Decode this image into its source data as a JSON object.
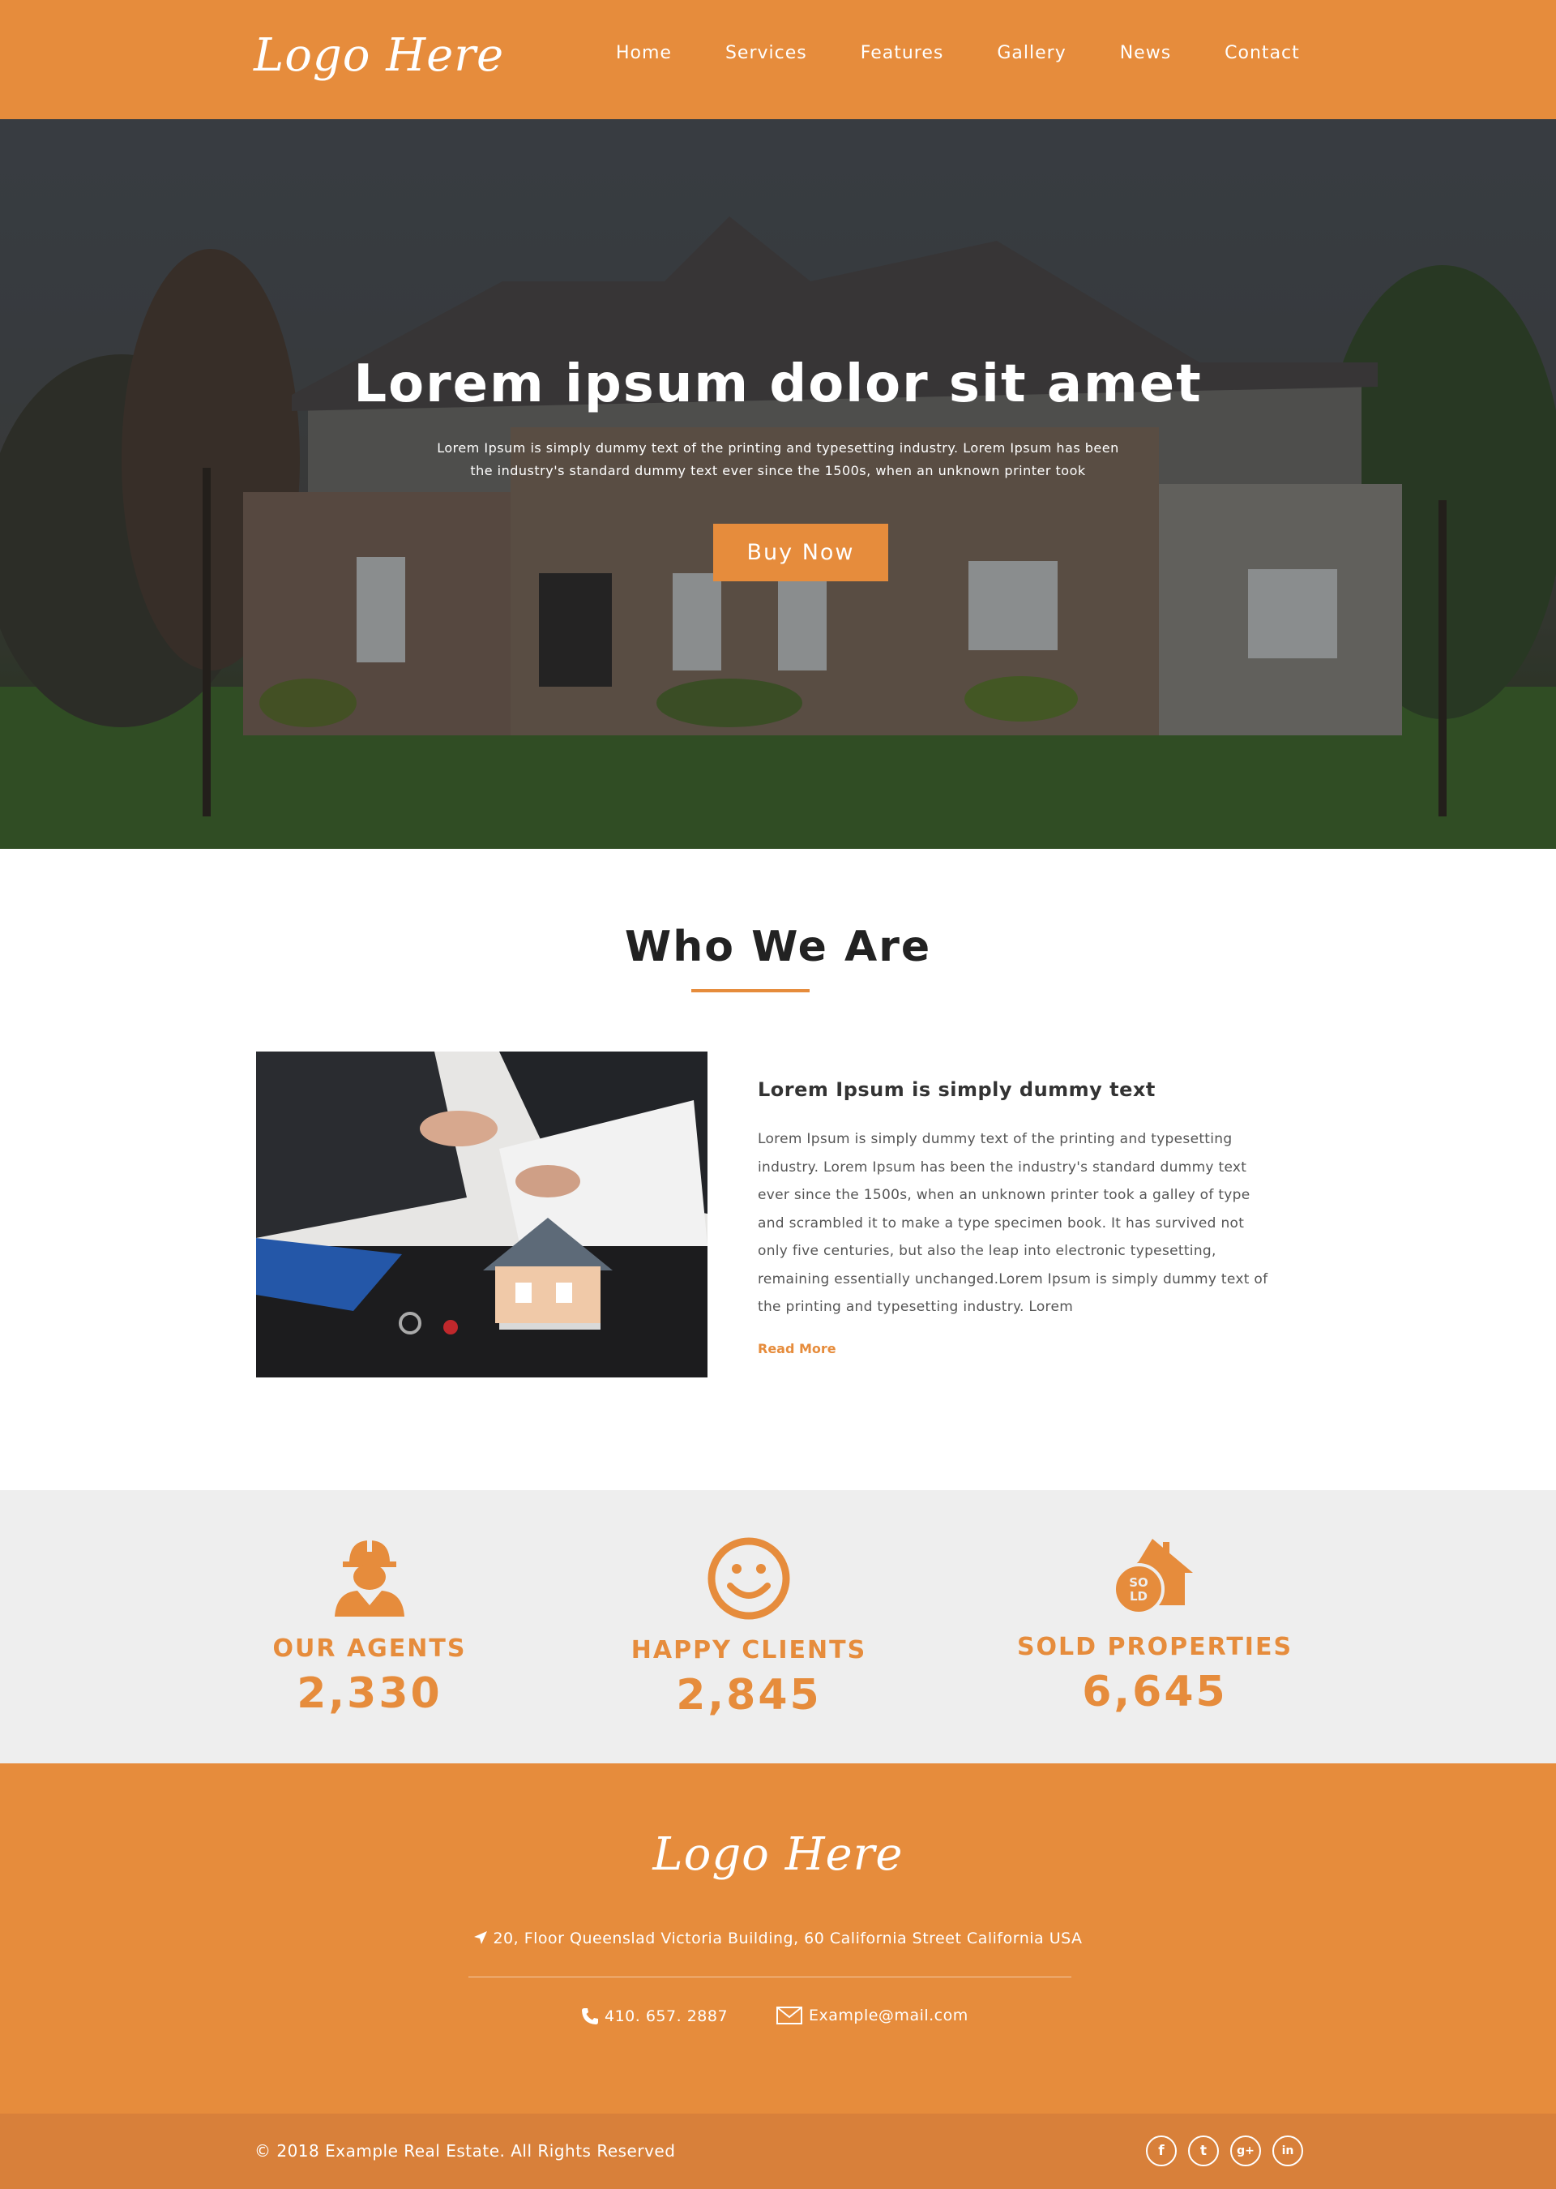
{
  "header": {
    "logo_text": "Logo Here",
    "nav": [
      "Home",
      "Services",
      "Features",
      "Gallery",
      "News",
      "Contact"
    ]
  },
  "hero": {
    "title": "Lorem ipsum dolor sit amet",
    "subtitle_line1": "Lorem Ipsum is simply dummy text of the printing and typesetting industry. Lorem Ipsum has been",
    "subtitle_line2": "the industry's standard dummy text ever since the 1500s, when an unknown printer took",
    "button_label": "Buy Now"
  },
  "about": {
    "section_title": "Who We Are",
    "heading": "Lorem Ipsum is simply dummy text",
    "body": "Lorem Ipsum is simply dummy text of the printing and typesetting industry. Lorem Ipsum has been the industry's standard dummy text ever since the 1500s, when an unknown printer took a galley of type and scrambled it to make a type specimen book. It has survived not only five centuries, but also the leap into electronic typesetting, remaining essentially unchanged.Lorem Ipsum is simply dummy text of the printing and typesetting industry. Lorem",
    "read_more": "Read More"
  },
  "stats": [
    {
      "label": "OUR AGENTS",
      "value": "2,330",
      "icon": "agent-icon"
    },
    {
      "label": "HAPPY CLIENTS",
      "value": "2,845",
      "icon": "smiley-icon"
    },
    {
      "label": "SOLD PROPERTIES",
      "value": "6,645",
      "icon": "sold-house-icon"
    }
  ],
  "footer": {
    "logo_text": "Logo Here",
    "address": "20, Floor Queenslad Victoria Building, 60 California Street California USA",
    "phone": "410. 657. 2887",
    "email": "Example@mail.com",
    "copyright": "© 2018 Example Real Estate. All Rights Reserved",
    "socials": [
      {
        "name": "facebook",
        "glyph": "f"
      },
      {
        "name": "twitter",
        "glyph": "t"
      },
      {
        "name": "google-plus",
        "glyph": "g+"
      },
      {
        "name": "linkedin",
        "glyph": "in"
      }
    ]
  },
  "colors": {
    "accent": "#e68c3c",
    "bottom_bar": "#d8803a",
    "stats_bg": "#eeeeee"
  }
}
